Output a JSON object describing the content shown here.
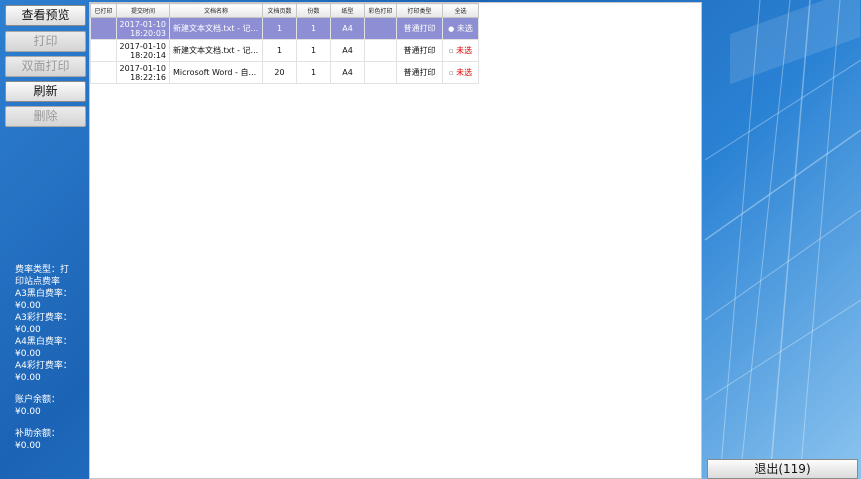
{
  "sidebar": {
    "buttons": [
      {
        "label": "查看预览",
        "enabled": true
      },
      {
        "label": "打印",
        "enabled": false
      },
      {
        "label": "双面打印",
        "enabled": false
      },
      {
        "label": "刷新",
        "enabled": true
      },
      {
        "label": "删除",
        "enabled": false
      }
    ],
    "rates": {
      "fee_type_label": "费率类型：打",
      "fee_type_value": "印站点费率",
      "a3_bw_label": "A3黑白费率：",
      "a3_bw_value": "¥0.00",
      "a3_color_label": "A3彩打费率：",
      "a3_color_value": "¥0.00",
      "a4_bw_label": "A4黑白费率：",
      "a4_bw_value": "¥0.00",
      "a4_color_label": "A4彩打费率：",
      "a4_color_value": "¥0.00",
      "balance_label": "账户余额：",
      "balance_value": "¥0.00",
      "subsidy_label": "补助余额：",
      "subsidy_value": "¥0.00"
    }
  },
  "table": {
    "headers": [
      "已打印",
      "提交时间",
      "文档名称",
      "文档页数",
      "份数",
      "纸型",
      "彩色打印",
      "打印类型",
      "全选"
    ],
    "rows": [
      {
        "printed": "",
        "date": "2017-01-10",
        "time": "18:20:03",
        "name": "新建文本文档.txt - 记...",
        "pages": "1",
        "copies": "1",
        "paper": "A4",
        "color": "",
        "type": "普通打印",
        "select": "未选",
        "selected": true
      },
      {
        "printed": "",
        "date": "2017-01-10",
        "time": "18:20:14",
        "name": "新建文本文档.txt - 记...",
        "pages": "1",
        "copies": "1",
        "paper": "A4",
        "color": "",
        "type": "普通打印",
        "select": "未选",
        "selected": false
      },
      {
        "printed": "",
        "date": "2017-01-10",
        "time": "18:22:16",
        "name": "Microsoft Word - 自...",
        "pages": "20",
        "copies": "1",
        "paper": "A4",
        "color": "",
        "type": "普通打印",
        "select": "未选",
        "selected": false
      }
    ]
  },
  "footer": {
    "exit_label": "退出(119)"
  },
  "colors": {
    "selected_row": "#8d8ed3",
    "unselected_text": "#e00000",
    "background_blue": "#1c63b5"
  }
}
